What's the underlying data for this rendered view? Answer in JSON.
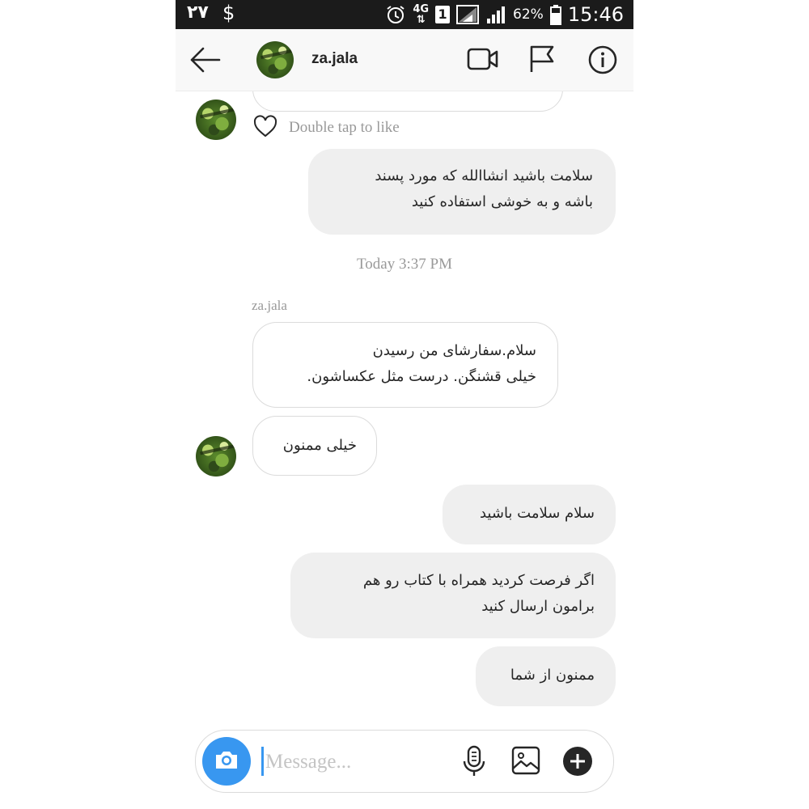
{
  "status_bar": {
    "left_number": "۲۷",
    "left_symbol": "$",
    "network": "4G",
    "sim": "1",
    "battery": "62%",
    "time": "15:46"
  },
  "header": {
    "username": "za.jala",
    "icons": [
      "back-arrow-icon",
      "video-camera-icon",
      "flag-icon",
      "info-icon"
    ]
  },
  "chat": {
    "like_hint": "Double tap to like",
    "timestamp": "Today 3:37 PM",
    "sender_name": "za.jala",
    "messages": [
      {
        "direction": "out",
        "lines": [
          "سلامت باشید انشاالله که مورد پسند",
          "باشه و به خوشی استفاده کنید"
        ]
      },
      {
        "direction": "in",
        "lines": [
          "سلام.سفارشای من رسیدن",
          "خیلی قشنگن. درست مثل عکساشون."
        ]
      },
      {
        "direction": "in",
        "lines": [
          "خیلی ممنون"
        ]
      },
      {
        "direction": "out",
        "lines": [
          "سلام سلامت باشید"
        ]
      },
      {
        "direction": "out",
        "lines": [
          "اگر فرصت کردید همراه با کتاب رو هم",
          "برامون ارسال کنید"
        ]
      },
      {
        "direction": "out",
        "lines": [
          "ممنون از شما"
        ]
      }
    ]
  },
  "composer": {
    "placeholder": "Message...",
    "icons": [
      "camera-icon",
      "microphone-icon",
      "gallery-icon",
      "plus-icon"
    ]
  },
  "colors": {
    "accent": "#3897f0",
    "status_bar": "#1b1b1b",
    "outgoing_bubble": "#efefef",
    "muted_text": "#999999"
  }
}
